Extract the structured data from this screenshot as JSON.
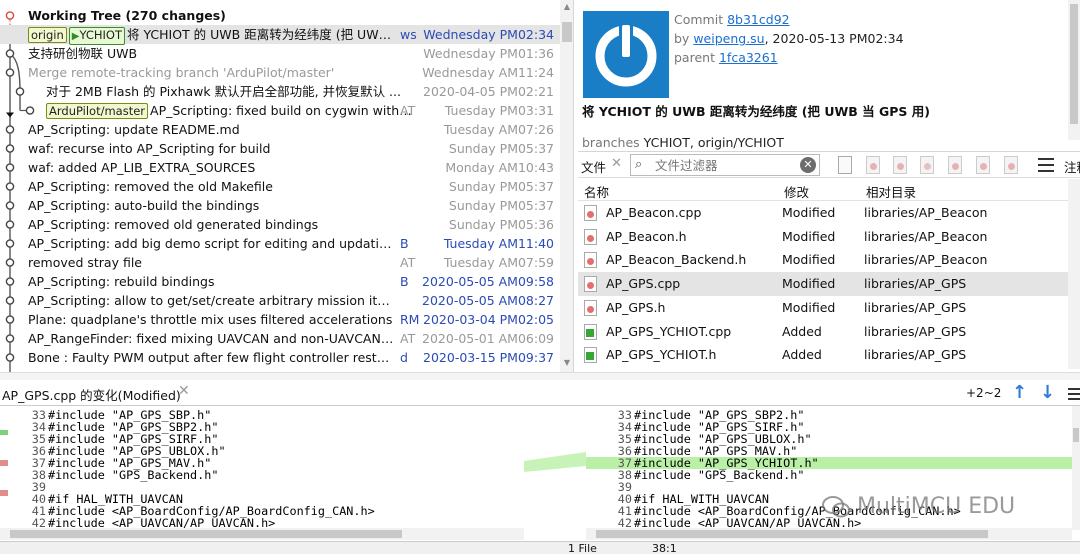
{
  "colors": {
    "accent_blue": "#2a4bb7",
    "link": "#1a6fd0",
    "avatar_bg": "#1a7ec6",
    "added_green": "#35a735",
    "modified_red": "#e46d6d",
    "diff_highlight": "#b9f0a6",
    "selection": "#e4e4e4"
  },
  "commits": [
    {
      "message": "Working Tree (270 changes)",
      "author": "",
      "date": "",
      "style": "bold"
    },
    {
      "message": "将 YCHIOT 的 UWB 距离转为经纬度 (把 UWB ...",
      "author": "ws",
      "date": "Wednesday PM02:34",
      "style": "sel",
      "tags": [
        {
          "text": "origin",
          "kind": "remote"
        },
        {
          "text": "YCHIOT",
          "kind": "branch"
        }
      ]
    },
    {
      "message": "支持研创物联 UWB",
      "author": "",
      "date": "Wednesday PM01:36",
      "style": "gray-meta"
    },
    {
      "message": "Merge remote-tracking branch 'ArduPilot/master'",
      "author": "",
      "date": "Wednesday AM11:24",
      "style": "dim"
    },
    {
      "message": "对于 2MB Flash 的 Pixhawk 默认开启全部功能, 并恢复默认 ...",
      "author": "",
      "date": "2020-04-05 PM02:21",
      "style": "gray-meta",
      "indent": 18
    },
    {
      "message": "AP_Scripting: fixed build on cygwin with ...",
      "author": "AT",
      "date": "Tuesday PM03:31",
      "style": "gray-meta",
      "tags": [
        {
          "text": "ArduPilot/master",
          "kind": "remote"
        }
      ],
      "indent": 18
    },
    {
      "message": "AP_Scripting: update README.md",
      "author": "",
      "date": "Tuesday AM07:26",
      "style": "gray-meta"
    },
    {
      "message": "waf: recurse into AP_Scripting for build",
      "author": "",
      "date": "Sunday PM05:37",
      "style": "gray-meta"
    },
    {
      "message": "waf: added AP_LIB_EXTRA_SOURCES",
      "author": "",
      "date": "Monday AM10:43",
      "style": "gray-meta"
    },
    {
      "message": "AP_Scripting: removed the old Makefile",
      "author": "",
      "date": "Sunday PM05:37",
      "style": "gray-meta"
    },
    {
      "message": "AP_Scripting: auto-build the bindings",
      "author": "",
      "date": "Sunday PM05:37",
      "style": "gray-meta"
    },
    {
      "message": "AP_Scripting: removed old generated bindings",
      "author": "",
      "date": "Sunday PM05:36",
      "style": "gray-meta"
    },
    {
      "message": "AP_Scripting: add big demo script for editing and updating ...",
      "author": "B",
      "date": "Tuesday AM11:40",
      "style": ""
    },
    {
      "message": "removed stray file",
      "author": "AT",
      "date": "Tuesday AM07:59",
      "style": "gray-meta"
    },
    {
      "message": "AP_Scripting: rebuild bindings",
      "author": "B",
      "date": "2020-05-05 AM09:58",
      "style": ""
    },
    {
      "message": "AP_Scripting: allow to get/set/create arbitrary mission items",
      "author": "",
      "date": "2020-05-05 AM08:27",
      "style": ""
    },
    {
      "message": "Plane: quadplane's throttle mix uses filtered accelerations",
      "author": "RM",
      "date": "2020-03-04 PM02:05",
      "style": ""
    },
    {
      "message": "AP_RangeFinder: fixed mixing UAVCAN and non-UAVCAN ra...",
      "author": "AT",
      "date": "2020-05-01 AM06:09",
      "style": "gray-meta"
    },
    {
      "message": "Bone : Faulty PWM output after few flight controller restarts ...",
      "author": "d",
      "date": "2020-03-15 PM09:37",
      "style": ""
    }
  ],
  "details": {
    "commit_label": "Commit",
    "commit_hash": "8b31cd92",
    "by_label": "by",
    "author": "weipeng.su",
    "date": ", 2020-05-13 PM02:34",
    "parent_label": "parent",
    "parent_hash": "1fca3261",
    "subject": "将 YCHIOT 的 UWB 距离转为经纬度 (把 UWB 当 GPS 用)",
    "branches_label": "branches",
    "branches": "YCHIOT, origin/YCHIOT"
  },
  "files_panel": {
    "tab_label": "文件",
    "filter_placeholder": "文件过滤器",
    "note_label": "注释",
    "col_name": "名称",
    "col_status": "修改",
    "col_dir": "相对目录",
    "files": [
      {
        "name": "AP_Beacon.cpp",
        "status": "Modified",
        "dir": "libraries/AP_Beacon",
        "kind": "modified"
      },
      {
        "name": "AP_Beacon.h",
        "status": "Modified",
        "dir": "libraries/AP_Beacon",
        "kind": "modified"
      },
      {
        "name": "AP_Beacon_Backend.h",
        "status": "Modified",
        "dir": "libraries/AP_Beacon",
        "kind": "modified"
      },
      {
        "name": "AP_GPS.cpp",
        "status": "Modified",
        "dir": "libraries/AP_GPS",
        "kind": "modified",
        "selected": true
      },
      {
        "name": "AP_GPS.h",
        "status": "Modified",
        "dir": "libraries/AP_GPS",
        "kind": "modified"
      },
      {
        "name": "AP_GPS_YCHIOT.cpp",
        "status": "Added",
        "dir": "libraries/AP_GPS",
        "kind": "added"
      },
      {
        "name": "AP_GPS_YCHIOT.h",
        "status": "Added",
        "dir": "libraries/AP_GPS",
        "kind": "added"
      }
    ]
  },
  "diff": {
    "title": "AP_GPS.cpp 的变化(Modified)",
    "count": "+2~2",
    "left_lines": [
      {
        "num": "33",
        "code": "#include \"AP_GPS_SBP.h\""
      },
      {
        "num": "34",
        "code": "#include \"AP_GPS_SBP2.h\""
      },
      {
        "num": "35",
        "code": "#include \"AP_GPS_SIRF.h\""
      },
      {
        "num": "36",
        "code": "#include \"AP_GPS_UBLOX.h\""
      },
      {
        "num": "37",
        "code": "#include \"AP_GPS_MAV.h\""
      },
      {
        "num": "38",
        "code": "#include \"GPS_Backend.h\""
      },
      {
        "num": "39",
        "code": ""
      },
      {
        "num": "40",
        "code": "#if HAL_WITH_UAVCAN"
      },
      {
        "num": "41",
        "code": "#include <AP_BoardConfig/AP_BoardConfig_CAN.h>"
      },
      {
        "num": "42",
        "code": "#include <AP_UAVCAN/AP_UAVCAN.h>"
      }
    ],
    "right_lines": [
      {
        "num": "33",
        "code": "#include \"AP_GPS_SBP2.h\""
      },
      {
        "num": "34",
        "code": "#include \"AP_GPS_SIRF.h\""
      },
      {
        "num": "35",
        "code": "#include \"AP_GPS_UBLOX.h\""
      },
      {
        "num": "36",
        "code": "#include \"AP_GPS_MAV.h\""
      },
      {
        "num": "37",
        "code": "#include \"AP_GPS_YCHIOT.h\"",
        "highlight": true
      },
      {
        "num": "38",
        "code": "#include \"GPS_Backend.h\""
      },
      {
        "num": "39",
        "code": ""
      },
      {
        "num": "40",
        "code": "#if HAL_WITH_UAVCAN"
      },
      {
        "num": "41",
        "code": "#include <AP_BoardConfig/AP_BoardConfig_CAN.h>"
      },
      {
        "num": "42",
        "code": "#include <AP_UAVCAN/AP_UAVCAN.h>"
      }
    ]
  },
  "status_bar": {
    "files": "1 File",
    "position": "38:1"
  },
  "watermark": "MultiMCU EDU"
}
